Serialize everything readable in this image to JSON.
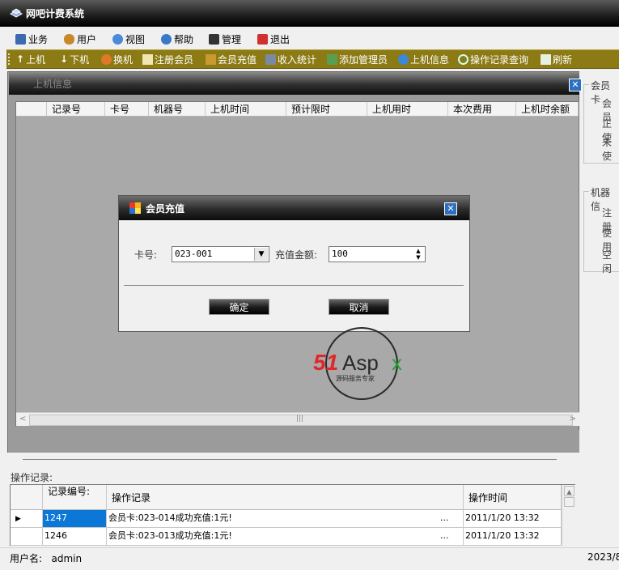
{
  "window": {
    "title": "网吧计费系统"
  },
  "menu": {
    "items": [
      "业务",
      "用户",
      "视图",
      "帮助",
      "管理",
      "退出"
    ]
  },
  "toolbar": {
    "items": [
      "上机",
      "下机",
      "换机",
      "注册会员",
      "会员充值",
      "收入统计",
      "添加管理员",
      "上机信息",
      "操作记录查询",
      "刷新"
    ]
  },
  "main": {
    "title": "上机信息",
    "columns": [
      "记录号",
      "卡号",
      "机器号",
      "上机时间",
      "预计限时",
      "上机用时",
      "本次费用",
      "上机时余额"
    ]
  },
  "right_panel": {
    "member_group": {
      "title": "会员卡",
      "rows": [
        "会员",
        "正使",
        "未使"
      ]
    },
    "machine_group": {
      "title": "机器信",
      "rows": [
        "注册",
        "使用",
        "空闲"
      ]
    }
  },
  "dialog": {
    "title": "会员充值",
    "card_label": "卡号:",
    "card_value": "023-001",
    "amount_label": "充值金额:",
    "amount_value": "100",
    "ok_label": "确定",
    "cancel_label": "取消"
  },
  "watermark": {
    "brand": "51Aspx",
    "tagline": "源码服务专家"
  },
  "log": {
    "label": "操作记录:",
    "columns": [
      "记录编号:",
      "操作记录",
      "操作时间"
    ],
    "rows": [
      {
        "id": "1247",
        "record": "会员卡:023-014成功充值:1元!",
        "more": "...",
        "time": "2011/1/20 13:32"
      },
      {
        "id": "1246",
        "record": "会员卡:023-013成功充值:1元!",
        "more": "...",
        "time": "2011/1/20 13:32"
      }
    ]
  },
  "status": {
    "user_label": "用户名:",
    "user_value": "admin",
    "date": "2023/8"
  }
}
